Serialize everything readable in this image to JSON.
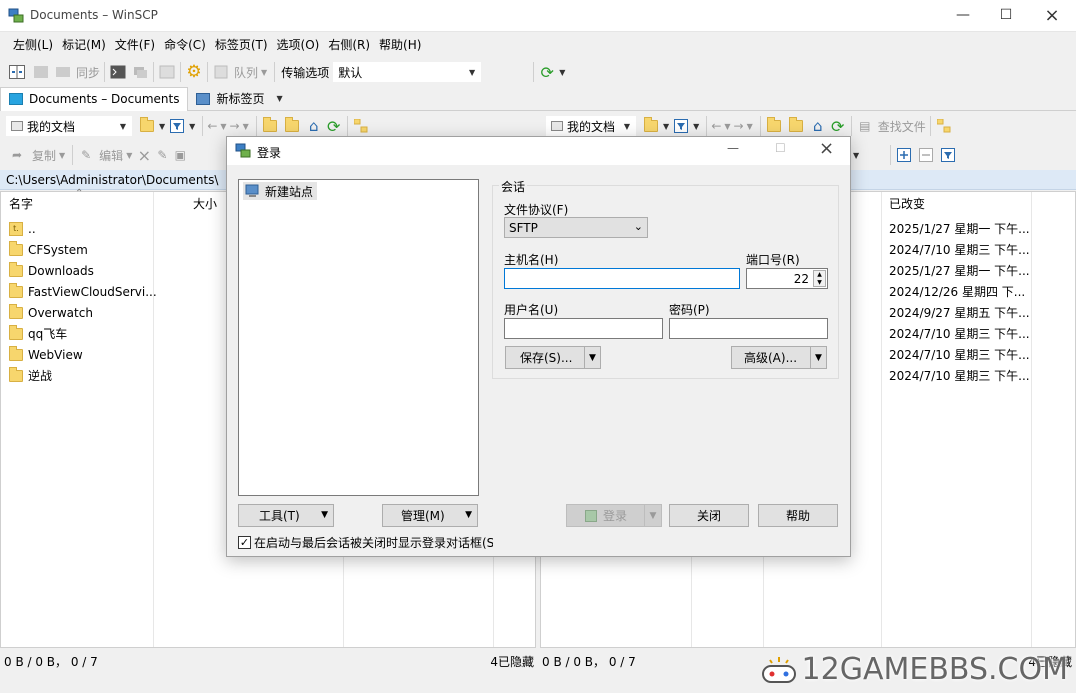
{
  "window": {
    "title": "Documents – WinSCP"
  },
  "menu": [
    "左侧(L)",
    "标记(M)",
    "文件(F)",
    "命令(C)",
    "标签页(T)",
    "选项(O)",
    "右侧(R)",
    "帮助(H)"
  ],
  "toolbar": {
    "sync_label": "同步",
    "queue_label": "队列",
    "transfer_options_label": "传输选项",
    "transfer_preset": "默认"
  },
  "tabs": [
    {
      "label": "Documents – Documents"
    },
    {
      "label": "新标签页"
    }
  ],
  "left_panel": {
    "location": "我的文档",
    "copy_label": "复制",
    "edit_label": "编辑",
    "path": "C:\\Users\\Administrator\\Documents\\",
    "columns": {
      "name": "名字",
      "size": "大小"
    },
    "files": [
      {
        "name": "..",
        "type": "updir"
      },
      {
        "name": "CFSystem",
        "type": "folder"
      },
      {
        "name": "Downloads",
        "type": "folder"
      },
      {
        "name": "FastViewCloudServi...",
        "type": "folder"
      },
      {
        "name": "Overwatch",
        "type": "folder"
      },
      {
        "name": "qq飞车",
        "type": "folder"
      },
      {
        "name": "WebView",
        "type": "folder"
      },
      {
        "name": "逆战",
        "type": "folder"
      }
    ],
    "status_left": "0 B / 0 B， 0 / 7",
    "status_right": "4已隐藏"
  },
  "right_panel": {
    "location": "我的文档",
    "find_files_label": "查找文件",
    "columns": {
      "changed": "已改变"
    },
    "dates": [
      "2025/1/27 星期一 下午...",
      "2024/7/10 星期三 下午...",
      "2025/1/27 星期一 下午...",
      "2024/12/26 星期四 下...",
      "2024/9/27 星期五 下午...",
      "2024/7/10 星期三 下午...",
      "2024/7/10 星期三 下午...",
      "2024/7/10 星期三 下午..."
    ],
    "status_left": "0 B / 0 B， 0 / 7",
    "status_right": "4已隐藏"
  },
  "login_dialog": {
    "title": "登录",
    "site_tree": [
      {
        "label": "新建站点"
      }
    ],
    "session_group_label": "会话",
    "protocol_label": "文件协议(F)",
    "protocol_value": "SFTP",
    "host_label": "主机名(H)",
    "host_value": "",
    "port_label": "端口号(R)",
    "port_value": "22",
    "user_label": "用户名(U)",
    "user_value": "",
    "password_label": "密码(P)",
    "password_value": "",
    "save_label": "保存(S)...",
    "advanced_label": "高级(A)...",
    "tools_label": "工具(T)",
    "manage_label": "管理(M)",
    "login_label": "登录",
    "close_label": "关闭",
    "help_label": "帮助",
    "show_on_startup_label": "在启动与最后会话被关闭时显示登录对话框(S",
    "show_on_startup_checked": true
  },
  "watermark": "12GAMEBBS.COM",
  "colors": {
    "accent": "#0078d7",
    "path_bar": "#dde9f6"
  }
}
